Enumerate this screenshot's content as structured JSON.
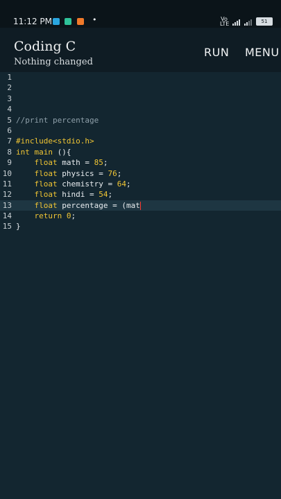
{
  "status": {
    "time": "11:12 PM",
    "notification_icons": [
      "app-blue-icon",
      "app-teal-icon",
      "app-orange-icon"
    ],
    "dot": "•",
    "network_label": "Vo LTE",
    "battery": "51"
  },
  "app_bar": {
    "title": "Coding C",
    "subtitle": "Nothing changed",
    "run_label": "RUN",
    "menu_label": "MENU"
  },
  "editor": {
    "lines": [
      {
        "n": "1",
        "tokens": []
      },
      {
        "n": "2",
        "tokens": []
      },
      {
        "n": "3",
        "tokens": []
      },
      {
        "n": "4",
        "tokens": []
      },
      {
        "n": "5",
        "tokens": [
          {
            "t": "//print percentage",
            "c": "cmt"
          }
        ]
      },
      {
        "n": "6",
        "tokens": []
      },
      {
        "n": "7",
        "tokens": [
          {
            "t": "#include",
            "c": "pre"
          },
          {
            "t": "<stdio.h>",
            "c": "pre"
          }
        ]
      },
      {
        "n": "8",
        "tokens": [
          {
            "t": "int",
            "c": "kw"
          },
          {
            "t": " ",
            "c": "txt"
          },
          {
            "t": "main",
            "c": "kw"
          },
          {
            "t": " (){",
            "c": "txt"
          }
        ]
      },
      {
        "n": "9",
        "tokens": [
          {
            "t": "    ",
            "c": "txt"
          },
          {
            "t": "float",
            "c": "kw"
          },
          {
            "t": " math = ",
            "c": "txt"
          },
          {
            "t": "85",
            "c": "num"
          },
          {
            "t": ";",
            "c": "txt"
          }
        ]
      },
      {
        "n": "10",
        "tokens": [
          {
            "t": "    ",
            "c": "txt"
          },
          {
            "t": "float",
            "c": "kw"
          },
          {
            "t": " physics = ",
            "c": "txt"
          },
          {
            "t": "76",
            "c": "num"
          },
          {
            "t": ";",
            "c": "txt"
          }
        ]
      },
      {
        "n": "11",
        "tokens": [
          {
            "t": "    ",
            "c": "txt"
          },
          {
            "t": "float",
            "c": "kw"
          },
          {
            "t": " chemistry = ",
            "c": "txt"
          },
          {
            "t": "64",
            "c": "num"
          },
          {
            "t": ";",
            "c": "txt"
          }
        ]
      },
      {
        "n": "12",
        "tokens": [
          {
            "t": "    ",
            "c": "txt"
          },
          {
            "t": "float",
            "c": "kw"
          },
          {
            "t": " hindi = ",
            "c": "txt"
          },
          {
            "t": "54",
            "c": "num"
          },
          {
            "t": ";",
            "c": "txt"
          }
        ]
      },
      {
        "n": "13",
        "active": true,
        "cursor": true,
        "tokens": [
          {
            "t": "    ",
            "c": "txt"
          },
          {
            "t": "float",
            "c": "kw"
          },
          {
            "t": " percentage = (mat",
            "c": "txt"
          }
        ]
      },
      {
        "n": "14",
        "tokens": [
          {
            "t": "    ",
            "c": "txt"
          },
          {
            "t": "return",
            "c": "kw"
          },
          {
            "t": " ",
            "c": "txt"
          },
          {
            "t": "0",
            "c": "num"
          },
          {
            "t": ";",
            "c": "txt"
          }
        ]
      },
      {
        "n": "15",
        "tokens": [
          {
            "t": "}",
            "c": "txt"
          }
        ]
      }
    ]
  }
}
